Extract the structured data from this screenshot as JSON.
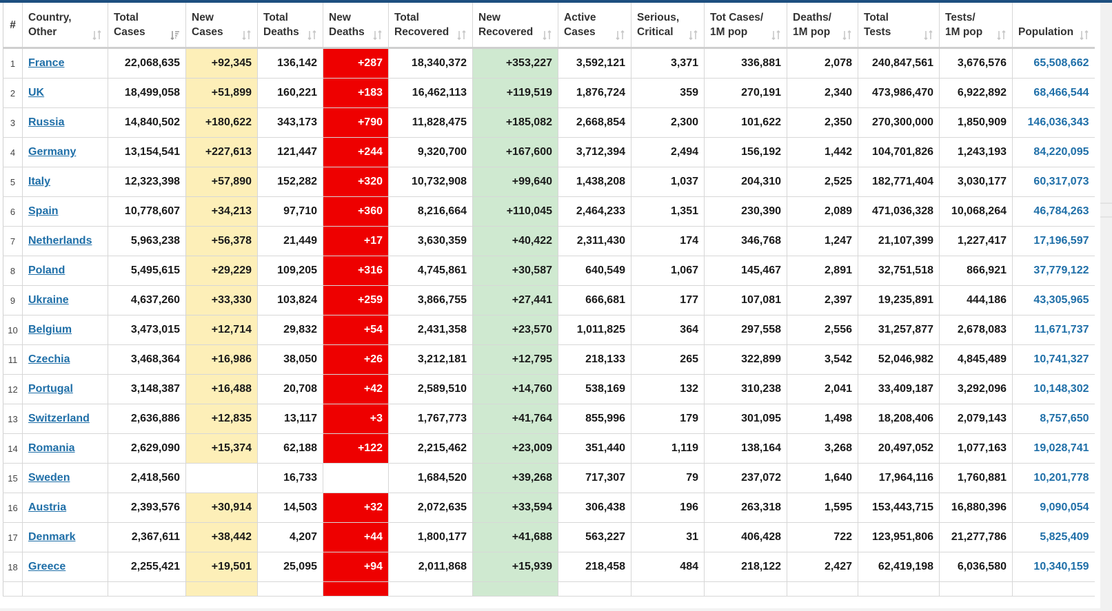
{
  "header": {
    "columns": [
      {
        "line1": "#",
        "line2": "",
        "sortable": false
      },
      {
        "line1": "Country,",
        "line2": "Other",
        "sortable": true
      },
      {
        "line1": "Total",
        "line2": "Cases",
        "sortable": true,
        "active_sort": true
      },
      {
        "line1": "New",
        "line2": "Cases",
        "sortable": true
      },
      {
        "line1": "Total",
        "line2": "Deaths",
        "sortable": true
      },
      {
        "line1": "New",
        "line2": "Deaths",
        "sortable": true
      },
      {
        "line1": "Total",
        "line2": "Recovered",
        "sortable": true
      },
      {
        "line1": "New",
        "line2": "Recovered",
        "sortable": true
      },
      {
        "line1": "Active",
        "line2": "Cases",
        "sortable": true
      },
      {
        "line1": "Serious,",
        "line2": "Critical",
        "sortable": true
      },
      {
        "line1": "Tot Cases/",
        "line2": "1M pop",
        "sortable": true
      },
      {
        "line1": "Deaths/",
        "line2": "1M pop",
        "sortable": true
      },
      {
        "line1": "Total",
        "line2": "Tests",
        "sortable": true
      },
      {
        "line1": "Tests/",
        "line2": "1M pop",
        "sortable": true
      },
      {
        "line1": "",
        "line2": "Population",
        "sortable": true
      }
    ]
  },
  "rows": [
    {
      "idx": "1",
      "country": "France",
      "total_cases": "22,068,635",
      "new_cases": "+92,345",
      "total_deaths": "136,142",
      "new_deaths": "+287",
      "total_recovered": "18,340,372",
      "new_recovered": "+353,227",
      "active": "3,592,121",
      "serious": "3,371",
      "cases_per_m": "336,881",
      "deaths_per_m": "2,078",
      "total_tests": "240,847,561",
      "tests_per_m": "3,676,576",
      "population": "65,508,662"
    },
    {
      "idx": "2",
      "country": "UK",
      "total_cases": "18,499,058",
      "new_cases": "+51,899",
      "total_deaths": "160,221",
      "new_deaths": "+183",
      "total_recovered": "16,462,113",
      "new_recovered": "+119,519",
      "active": "1,876,724",
      "serious": "359",
      "cases_per_m": "270,191",
      "deaths_per_m": "2,340",
      "total_tests": "473,986,470",
      "tests_per_m": "6,922,892",
      "population": "68,466,544"
    },
    {
      "idx": "3",
      "country": "Russia",
      "total_cases": "14,840,502",
      "new_cases": "+180,622",
      "total_deaths": "343,173",
      "new_deaths": "+790",
      "total_recovered": "11,828,475",
      "new_recovered": "+185,082",
      "active": "2,668,854",
      "serious": "2,300",
      "cases_per_m": "101,622",
      "deaths_per_m": "2,350",
      "total_tests": "270,300,000",
      "tests_per_m": "1,850,909",
      "population": "146,036,343"
    },
    {
      "idx": "4",
      "country": "Germany",
      "total_cases": "13,154,541",
      "new_cases": "+227,613",
      "total_deaths": "121,447",
      "new_deaths": "+244",
      "total_recovered": "9,320,700",
      "new_recovered": "+167,600",
      "active": "3,712,394",
      "serious": "2,494",
      "cases_per_m": "156,192",
      "deaths_per_m": "1,442",
      "total_tests": "104,701,826",
      "tests_per_m": "1,243,193",
      "population": "84,220,095"
    },
    {
      "idx": "5",
      "country": "Italy",
      "total_cases": "12,323,398",
      "new_cases": "+57,890",
      "total_deaths": "152,282",
      "new_deaths": "+320",
      "total_recovered": "10,732,908",
      "new_recovered": "+99,640",
      "active": "1,438,208",
      "serious": "1,037",
      "cases_per_m": "204,310",
      "deaths_per_m": "2,525",
      "total_tests": "182,771,404",
      "tests_per_m": "3,030,177",
      "population": "60,317,073"
    },
    {
      "idx": "6",
      "country": "Spain",
      "total_cases": "10,778,607",
      "new_cases": "+34,213",
      "total_deaths": "97,710",
      "new_deaths": "+360",
      "total_recovered": "8,216,664",
      "new_recovered": "+110,045",
      "active": "2,464,233",
      "serious": "1,351",
      "cases_per_m": "230,390",
      "deaths_per_m": "2,089",
      "total_tests": "471,036,328",
      "tests_per_m": "10,068,264",
      "population": "46,784,263"
    },
    {
      "idx": "7",
      "country": "Netherlands",
      "total_cases": "5,963,238",
      "new_cases": "+56,378",
      "total_deaths": "21,449",
      "new_deaths": "+17",
      "total_recovered": "3,630,359",
      "new_recovered": "+40,422",
      "active": "2,311,430",
      "serious": "174",
      "cases_per_m": "346,768",
      "deaths_per_m": "1,247",
      "total_tests": "21,107,399",
      "tests_per_m": "1,227,417",
      "population": "17,196,597"
    },
    {
      "idx": "8",
      "country": "Poland",
      "total_cases": "5,495,615",
      "new_cases": "+29,229",
      "total_deaths": "109,205",
      "new_deaths": "+316",
      "total_recovered": "4,745,861",
      "new_recovered": "+30,587",
      "active": "640,549",
      "serious": "1,067",
      "cases_per_m": "145,467",
      "deaths_per_m": "2,891",
      "total_tests": "32,751,518",
      "tests_per_m": "866,921",
      "population": "37,779,122"
    },
    {
      "idx": "9",
      "country": "Ukraine",
      "total_cases": "4,637,260",
      "new_cases": "+33,330",
      "total_deaths": "103,824",
      "new_deaths": "+259",
      "total_recovered": "3,866,755",
      "new_recovered": "+27,441",
      "active": "666,681",
      "serious": "177",
      "cases_per_m": "107,081",
      "deaths_per_m": "2,397",
      "total_tests": "19,235,891",
      "tests_per_m": "444,186",
      "population": "43,305,965"
    },
    {
      "idx": "10",
      "country": "Belgium",
      "total_cases": "3,473,015",
      "new_cases": "+12,714",
      "total_deaths": "29,832",
      "new_deaths": "+54",
      "total_recovered": "2,431,358",
      "new_recovered": "+23,570",
      "active": "1,011,825",
      "serious": "364",
      "cases_per_m": "297,558",
      "deaths_per_m": "2,556",
      "total_tests": "31,257,877",
      "tests_per_m": "2,678,083",
      "population": "11,671,737"
    },
    {
      "idx": "11",
      "country": "Czechia",
      "total_cases": "3,468,364",
      "new_cases": "+16,986",
      "total_deaths": "38,050",
      "new_deaths": "+26",
      "total_recovered": "3,212,181",
      "new_recovered": "+12,795",
      "active": "218,133",
      "serious": "265",
      "cases_per_m": "322,899",
      "deaths_per_m": "3,542",
      "total_tests": "52,046,982",
      "tests_per_m": "4,845,489",
      "population": "10,741,327"
    },
    {
      "idx": "12",
      "country": "Portugal",
      "total_cases": "3,148,387",
      "new_cases": "+16,488",
      "total_deaths": "20,708",
      "new_deaths": "+42",
      "total_recovered": "2,589,510",
      "new_recovered": "+14,760",
      "active": "538,169",
      "serious": "132",
      "cases_per_m": "310,238",
      "deaths_per_m": "2,041",
      "total_tests": "33,409,187",
      "tests_per_m": "3,292,096",
      "population": "10,148,302"
    },
    {
      "idx": "13",
      "country": "Switzerland",
      "total_cases": "2,636,886",
      "new_cases": "+12,835",
      "total_deaths": "13,117",
      "new_deaths": "+3",
      "total_recovered": "1,767,773",
      "new_recovered": "+41,764",
      "active": "855,996",
      "serious": "179",
      "cases_per_m": "301,095",
      "deaths_per_m": "1,498",
      "total_tests": "18,208,406",
      "tests_per_m": "2,079,143",
      "population": "8,757,650"
    },
    {
      "idx": "14",
      "country": "Romania",
      "total_cases": "2,629,090",
      "new_cases": "+15,374",
      "total_deaths": "62,188",
      "new_deaths": "+122",
      "total_recovered": "2,215,462",
      "new_recovered": "+23,009",
      "active": "351,440",
      "serious": "1,119",
      "cases_per_m": "138,164",
      "deaths_per_m": "3,268",
      "total_tests": "20,497,052",
      "tests_per_m": "1,077,163",
      "population": "19,028,741"
    },
    {
      "idx": "15",
      "country": "Sweden",
      "total_cases": "2,418,560",
      "new_cases": "",
      "total_deaths": "16,733",
      "new_deaths": "",
      "total_recovered": "1,684,520",
      "new_recovered": "+39,268",
      "active": "717,307",
      "serious": "79",
      "cases_per_m": "237,072",
      "deaths_per_m": "1,640",
      "total_tests": "17,964,116",
      "tests_per_m": "1,760,881",
      "population": "10,201,778"
    },
    {
      "idx": "16",
      "country": "Austria",
      "total_cases": "2,393,576",
      "new_cases": "+30,914",
      "total_deaths": "14,503",
      "new_deaths": "+32",
      "total_recovered": "2,072,635",
      "new_recovered": "+33,594",
      "active": "306,438",
      "serious": "196",
      "cases_per_m": "263,318",
      "deaths_per_m": "1,595",
      "total_tests": "153,443,715",
      "tests_per_m": "16,880,396",
      "population": "9,090,054"
    },
    {
      "idx": "17",
      "country": "Denmark",
      "total_cases": "2,367,611",
      "new_cases": "+38,442",
      "total_deaths": "4,207",
      "new_deaths": "+44",
      "total_recovered": "1,800,177",
      "new_recovered": "+41,688",
      "active": "563,227",
      "serious": "31",
      "cases_per_m": "406,428",
      "deaths_per_m": "722",
      "total_tests": "123,951,806",
      "tests_per_m": "21,277,786",
      "population": "5,825,409"
    },
    {
      "idx": "18",
      "country": "Greece",
      "total_cases": "2,255,421",
      "new_cases": "+19,501",
      "total_deaths": "25,095",
      "new_deaths": "+94",
      "total_recovered": "2,011,868",
      "new_recovered": "+15,939",
      "active": "218,458",
      "serious": "484",
      "cases_per_m": "218,122",
      "deaths_per_m": "2,427",
      "total_tests": "62,419,198",
      "tests_per_m": "6,036,580",
      "population": "10,340,159"
    }
  ],
  "colors": {
    "new_cases_bg": "#fdefb8",
    "new_deaths_bg": "#ee0000",
    "new_recovered_bg": "#cfe9d0",
    "link": "#1f6fa8",
    "top_bar": "#1d4f7f"
  },
  "icons": {
    "sort": "sort-arrows-icon",
    "active_sort": "sort-descending-icon"
  }
}
